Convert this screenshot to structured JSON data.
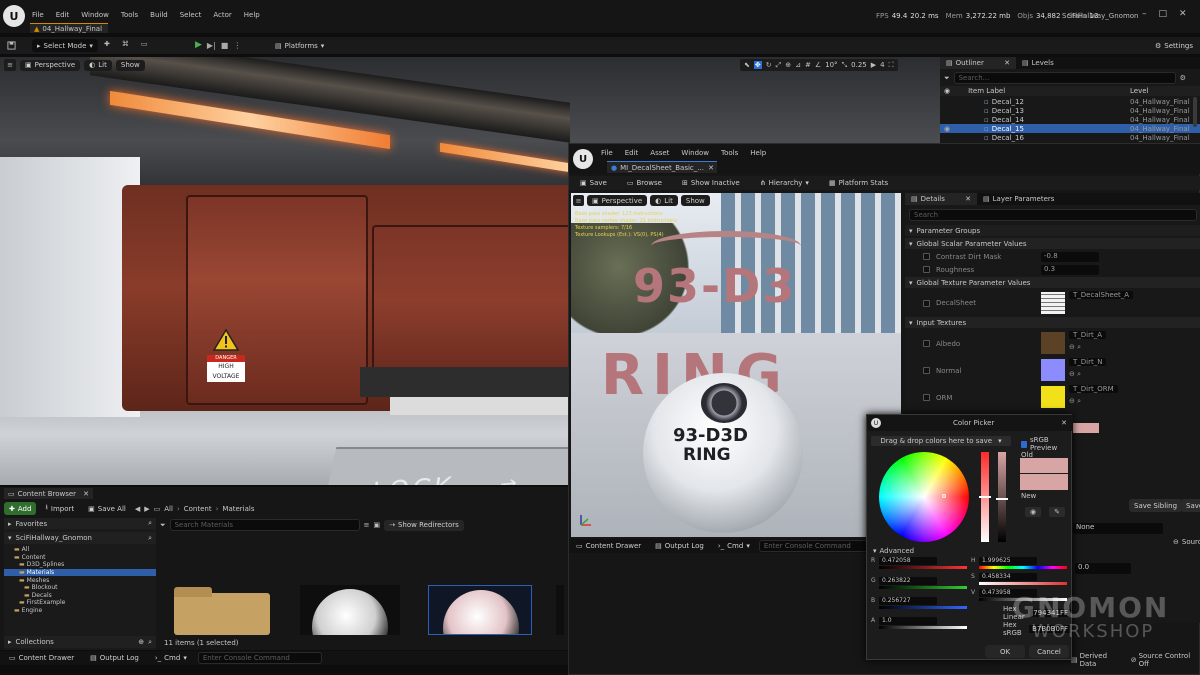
{
  "main_menu": [
    "File",
    "Edit",
    "Window",
    "Tools",
    "Build",
    "Select",
    "Actor",
    "Help"
  ],
  "stats": {
    "fps_label": "FPS",
    "fps": "49.4",
    "ms": "20.2 ms",
    "mem_label": "Mem",
    "mem": "3,272.22 mb",
    "objs_label": "Objs",
    "objs": "34,882",
    "stalls_label": "Stalls",
    "stalls": "13"
  },
  "project_name": "SciFiHallway_Gnomon",
  "level_tab": "04_Hallway_Final",
  "toolbar": {
    "select_mode": "Select Mode",
    "platforms": "Platforms",
    "settings": "Settings"
  },
  "viewport": {
    "perspective": "Perspective",
    "lit": "Lit",
    "show": "Show",
    "snap_angle": "10°",
    "snap_scale": "0.25",
    "camera_speed": "4",
    "sign_danger": "DANGER",
    "sign_text1": "HIGH",
    "sign_text2": "VOLTAGE",
    "floor_text": "LOCK"
  },
  "outliner": {
    "tab": "Outliner",
    "levels_tab": "Levels",
    "search_placeholder": "Search...",
    "col_item": "Item Label",
    "col_level": "Level",
    "rows": [
      {
        "label": "Decal_12",
        "level": "04_Hallway_Final"
      },
      {
        "label": "Decal_13",
        "level": "04_Hallway_Final"
      },
      {
        "label": "Decal_14",
        "level": "04_Hallway_Final"
      },
      {
        "label": "Decal_15",
        "level": "04_Hallway_Final"
      },
      {
        "label": "Decal_16",
        "level": "04_Hallway_Final"
      }
    ]
  },
  "content_browser": {
    "tab": "Content Browser",
    "add": "Add",
    "import": "Import",
    "save_all": "Save All",
    "path": [
      "All",
      "Content",
      "Materials"
    ],
    "favorites": "Favorites",
    "root": "SciFiHallway_Gnomon",
    "tree": [
      "All",
      "Content",
      "D3D_Splines",
      "Materials",
      "Meshes",
      "Blockout",
      "Decals",
      "FirstExample",
      "Engine"
    ],
    "search_placeholder": "Search Materials",
    "show_redirectors": "Show Redirectors",
    "collections": "Collections",
    "count": "11 items (1 selected)"
  },
  "bottom_bar": {
    "content_drawer": "Content Drawer",
    "output_log": "Output Log",
    "cmd": "Cmd",
    "console_placeholder": "Enter Console Command"
  },
  "material_editor": {
    "menu": [
      "File",
      "Edit",
      "Asset",
      "Window",
      "Tools",
      "Help"
    ],
    "tab": "MI_DecalSheet_Basic_...",
    "toolbar": [
      "Save",
      "Browse",
      "Show Inactive",
      "Hierarchy",
      "Platform Stats"
    ],
    "viewport_perspective": "Perspective",
    "viewport_lit": "Lit",
    "viewport_show": "Show",
    "stats_lines": [
      "Base pass shader: 123 instructions",
      "Base pass vertex shader: 21 instructions",
      "Texture samplers: 7/16",
      "Texture Lookups (Est.): VS(0), PS(4)"
    ],
    "decal_text1": "93-D3",
    "decal_text2": "RING",
    "sphere_text1": "93-D3D",
    "sphere_text2": "RING",
    "details_tab": "Details",
    "layer_tab": "Layer Parameters",
    "search_placeholder": "Search",
    "parameter_groups": "Parameter Groups",
    "global_scalar": "Global Scalar Parameter Values",
    "scalar_rows": [
      {
        "label": "Contrast Dirt Mask",
        "value": "-0.8"
      },
      {
        "label": "Roughness",
        "value": "0.3"
      }
    ],
    "global_texture": "Global Texture Parameter Values",
    "decal_sheet": "DecalSheet",
    "decal_sheet_asset": "T_DecalSheet_A",
    "input_textures": "Input Textures",
    "texture_rows": [
      {
        "label": "Albedo",
        "asset": "T_Dirt_A"
      },
      {
        "label": "Normal",
        "asset": "T_Dirt_N"
      },
      {
        "label": "ORM",
        "asset": "T_Dirt_ORM"
      }
    ],
    "save_sibling": "Save Sibling",
    "save_child": "Save C",
    "none_label": "None",
    "value_00": "0.0",
    "source_label": "Sourc",
    "bottom": {
      "content_drawer": "Content Drawer",
      "output_log": "Output Log",
      "cmd": "Cmd",
      "console_placeholder": "Enter Console Command"
    },
    "derived_data": "Derived Data",
    "source_control": "Source Control Off"
  },
  "color_picker": {
    "title": "Color Picker",
    "drag_drop": "Drag & drop colors here to save",
    "srgb": "sRGB Preview",
    "old_label": "Old",
    "new_label": "New",
    "advanced": "Advanced",
    "r": "0.472058",
    "g": "0.263822",
    "b": "0.256727",
    "a": "1.0",
    "h": "1.999625",
    "s": "0.458334",
    "v": "0.473958",
    "hex_linear_label": "Hex Linear",
    "hex_linear": "794341FF",
    "hex_srgb_label": "Hex sRGB",
    "hex_srgb": "B7B0B0FF",
    "ok": "OK",
    "cancel": "Cancel",
    "current_color": "#d8a5a5"
  },
  "watermark": {
    "line1": "GNOMON",
    "line2": "WORKSHOP"
  }
}
